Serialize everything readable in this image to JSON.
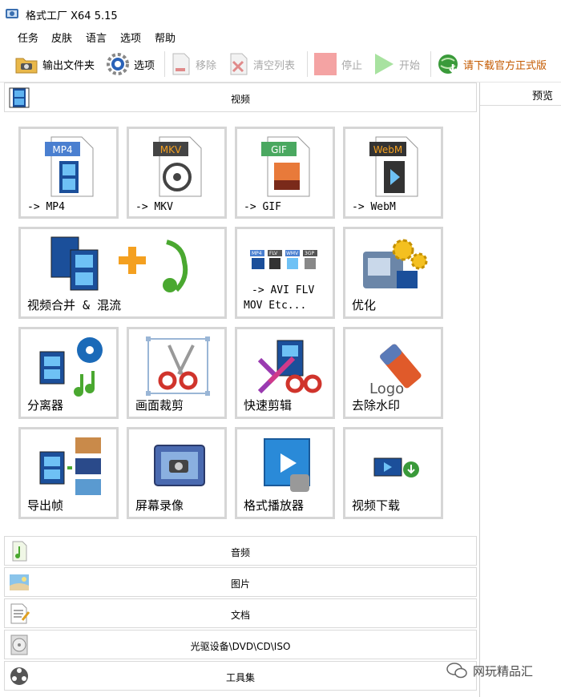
{
  "window": {
    "title": "格式工厂 X64 5.15"
  },
  "menu": [
    "任务",
    "皮肤",
    "语言",
    "选项",
    "帮助"
  ],
  "toolbar": {
    "output_folder": "输出文件夹",
    "options": "选项",
    "remove": "移除",
    "clear_list": "清空列表",
    "stop": "停止",
    "start": "开始",
    "download_official": "请下载官方正式版"
  },
  "categories": {
    "video": "视频",
    "audio": "音频",
    "image": "图片",
    "document": "文档",
    "disc": "光驱设备\\DVD\\CD\\ISO",
    "tools": "工具集"
  },
  "video_tiles": [
    {
      "label": "-> MP4",
      "badge": "MP4"
    },
    {
      "label": "-> MKV",
      "badge": "MKV"
    },
    {
      "label": "-> GIF",
      "badge": "GIF"
    },
    {
      "label": "-> WebM",
      "badge": "WebM"
    },
    {
      "label": "视频合并 & 混流"
    },
    {
      "label_line1": "-> AVI FLV",
      "label_line2": "MOV Etc...",
      "badges": [
        "MP4",
        "FLV",
        "WMV",
        "3GP"
      ]
    },
    {
      "label": "优化"
    },
    {
      "label": "分离器"
    },
    {
      "label": "画面裁剪"
    },
    {
      "label": "快速剪辑"
    },
    {
      "label": "去除水印",
      "logo_text": "Logo"
    },
    {
      "label": "导出帧"
    },
    {
      "label": "屏幕录像"
    },
    {
      "label": "格式播放器"
    },
    {
      "label": "视频下载"
    }
  ],
  "preview": {
    "label": "预览"
  },
  "watermark": {
    "text": "网玩精品汇"
  },
  "colors": {
    "accent_blue": "#1e5fb5",
    "download_text": "#c45a00",
    "tile_border": "#d6d6d6"
  }
}
